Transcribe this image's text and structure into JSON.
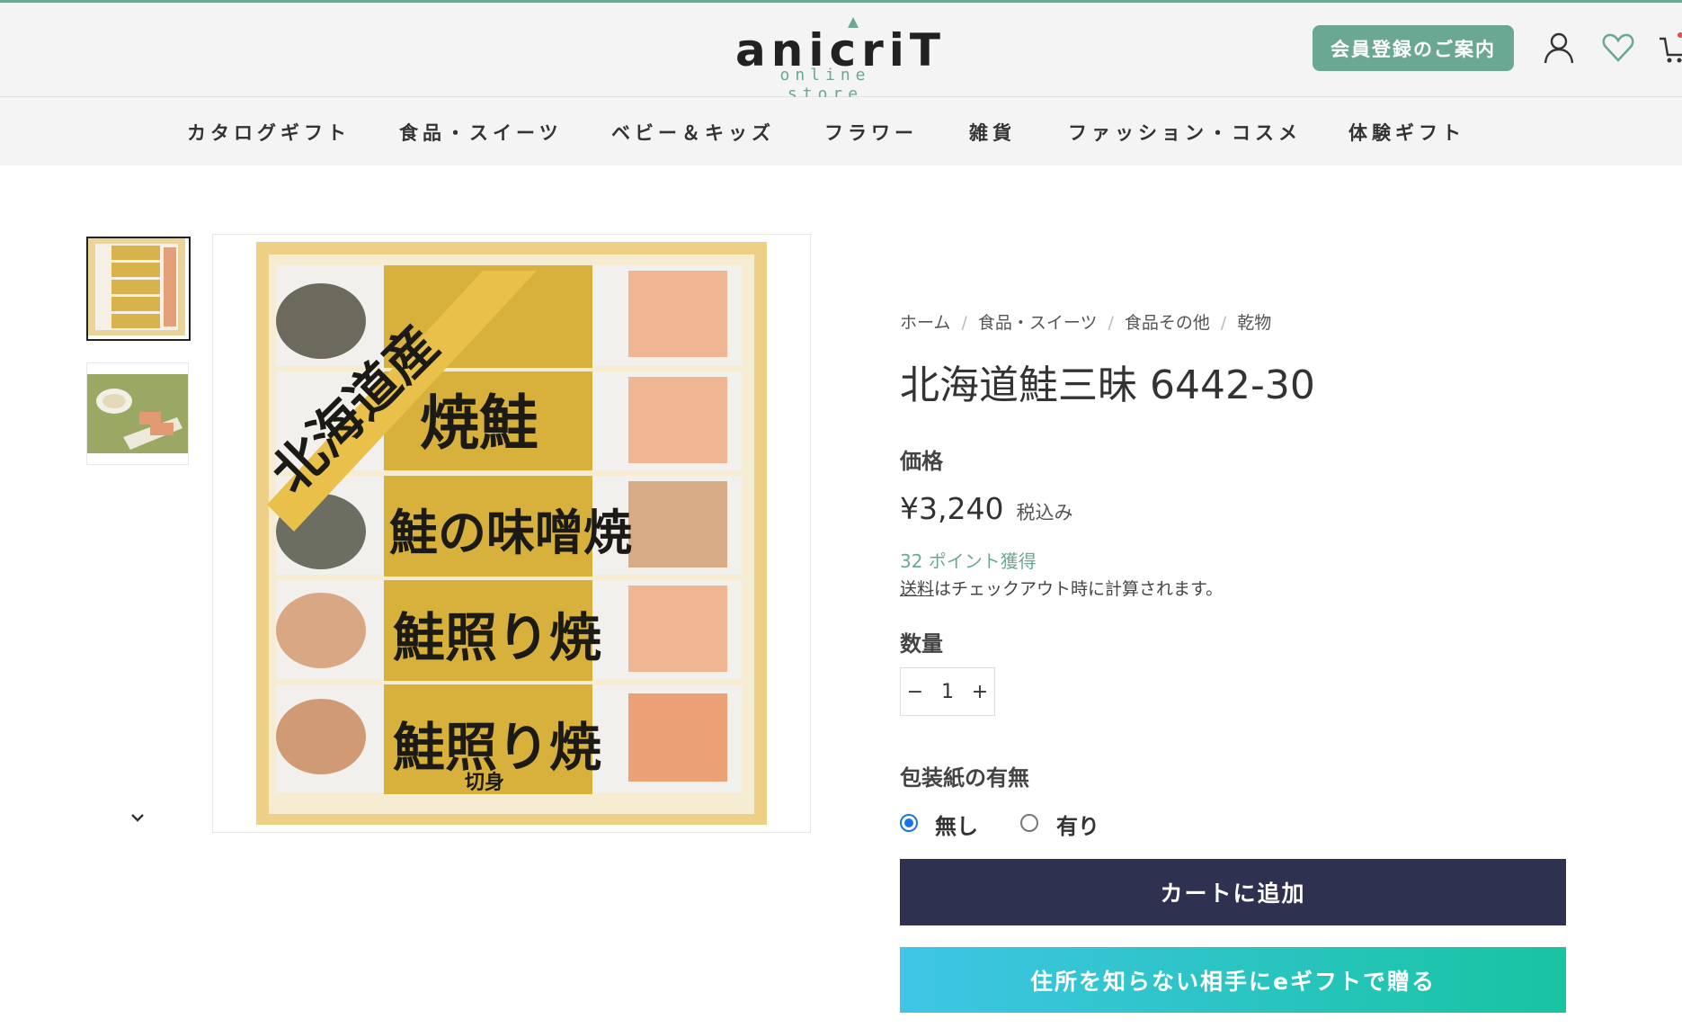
{
  "header": {
    "logo_main": "anicriT",
    "logo_sub": "online store",
    "member_button_label": "会員登録のご案内",
    "icons": [
      "account-icon",
      "heart-icon",
      "cart-icon"
    ],
    "accent_color": "#6aa893"
  },
  "nav": {
    "items": [
      {
        "label": "カタログギフト"
      },
      {
        "label": "食品・スイーツ"
      },
      {
        "label": "ベビー＆キッズ"
      },
      {
        "label": "フラワー"
      },
      {
        "label": "雑貨"
      },
      {
        "label": "ファッション・コスメ"
      },
      {
        "label": "体験ギフト"
      }
    ]
  },
  "gallery": {
    "thumbnails": [
      "product-box-thumbnail",
      "serving-plate-thumbnail"
    ],
    "image_texts": [
      "北海道産",
      "焼鮭",
      "鮭の味噌焼",
      "鮭照り焼",
      "鮭照り焼",
      "切身"
    ],
    "down_icon": "chevron-down-icon"
  },
  "product": {
    "breadcrumb": [
      "ホーム",
      "食品・スイーツ",
      "食品その他",
      "乾物"
    ],
    "title": "北海道鮭三昧 6442-30",
    "price_label": "価格",
    "price": "¥3,240",
    "tax_note": "税込み",
    "points": "32 ポイント獲得",
    "shipping_link": "送料",
    "shipping_rest": "はチェックアウト時に計算されます。",
    "quantity_label": "数量",
    "quantity_value": "1",
    "minus": "−",
    "plus": "+",
    "wrapping_label": "包装紙の有無",
    "wrapping_options": [
      {
        "label": "無し",
        "selected": true
      },
      {
        "label": "有り",
        "selected": false
      }
    ],
    "add_to_cart": "カートに追加",
    "egift_button": "住所を知らない相手にeギフトで贈る",
    "cart_button_color": "#2f3150"
  }
}
